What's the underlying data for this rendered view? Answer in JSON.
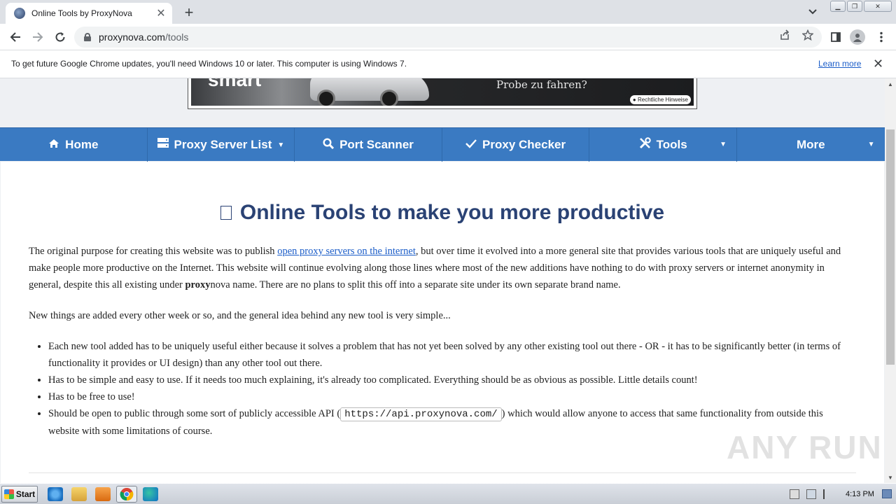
{
  "browser": {
    "tab_title": "Online Tools by ProxyNova",
    "tab_close": "✕",
    "new_tab": "+",
    "url_host": "proxynova.com",
    "url_path": "/tools"
  },
  "infobar": {
    "message": "To get future Google Chrome updates, you'll need Windows 10 or later. This computer is using Windows 7.",
    "link": "Learn more",
    "close": "✕"
  },
  "ad": {
    "brand": "smart",
    "tagline": "Probe zu fahren?",
    "legal": "Rechtliche Hinweise"
  },
  "nav": {
    "items": [
      {
        "label": "Home",
        "icon": "home-icon"
      },
      {
        "label": "Proxy Server List",
        "icon": "server-icon",
        "dropdown": true
      },
      {
        "label": "Port Scanner",
        "icon": "search-icon"
      },
      {
        "label": "Proxy Checker",
        "icon": "check-icon"
      },
      {
        "label": "Tools",
        "icon": "tools-icon",
        "dropdown": true
      },
      {
        "label": "More",
        "dropdown": true
      }
    ]
  },
  "content": {
    "title": "Online Tools to make you more productive",
    "intro_before_link": "The original purpose for creating this website was to publish ",
    "intro_link": "open proxy servers on the internet",
    "intro_after_link": ", but over time it evolved into a more general site that provides various tools that are uniquely useful and make people more productive on the Internet. This website will continue evolving along those lines where most of the new additions have nothing to do with proxy servers or internet anonymity in general, despite this all existing under ",
    "intro_bold": "proxy",
    "intro_end": "nova name. There are no plans to split this off into a separate site under its own separate brand name.",
    "para2": "New things are added every other week or so, and the general idea behind any new tool is very simple...",
    "bullets": [
      "Each new tool added has to be uniquely useful either because it solves a problem that has not yet been solved by any other existing tool out there - OR - it has to be significantly better (in terms of functionality it provides or UI design) than any other tool out there.",
      "Has to be simple and easy to use. If it needs too much explaining, it's already too complicated. Everything should be as obvious as possible. Little details count!",
      "Has to be free to use!"
    ],
    "bullet4_before": "Should be open to public through some sort of publicly accessible API (",
    "bullet4_code": "https://api.proxynova.com/",
    "bullet4_after": ") which would allow anyone to access that same functionality from outside this website with some limitations of course."
  },
  "watermark": "ANY RUN",
  "taskbar": {
    "start": "Start",
    "clock": "4:13 PM"
  },
  "colors": {
    "nav_bg": "#3a7ac2",
    "title": "#2a4274",
    "link": "#1a5cc8"
  }
}
